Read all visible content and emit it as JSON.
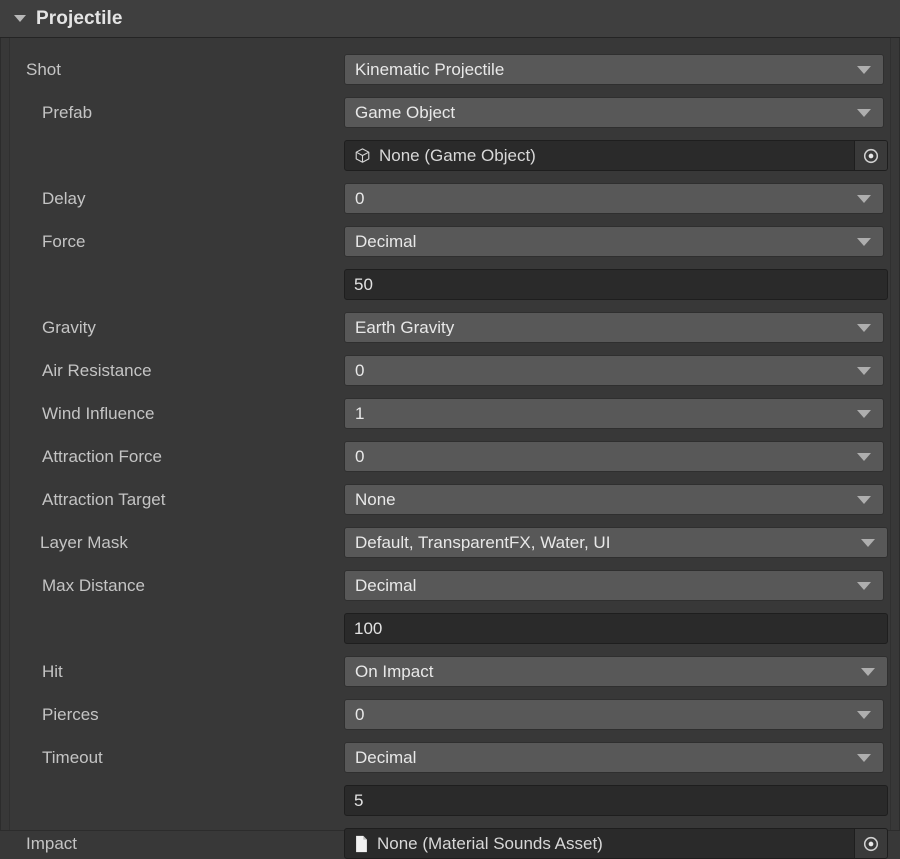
{
  "component": {
    "title": "Projectile",
    "foldout_icon": "chevron-down-icon",
    "expanded": true
  },
  "colors": {
    "panel_bg": "#383838",
    "header_bg": "#3f3f3f",
    "dropdown_bg": "#585858",
    "textfield_bg": "#2a2a2a",
    "label_text": "#c4c4c4",
    "value_text": "#e8e8e8"
  },
  "fields": [
    {
      "label": "Shot",
      "indent": 1,
      "control": "dropdown",
      "value": "Kinematic Projectile"
    },
    {
      "label": "Prefab",
      "indent": 2,
      "control": "dropdown",
      "value": "Game Object"
    },
    {
      "label": "",
      "indent": 2,
      "control": "objectfield",
      "value": "None (Game Object)",
      "icon": "cube-icon"
    },
    {
      "label": "Delay",
      "indent": 2,
      "control": "dropdown",
      "value": "0"
    },
    {
      "label": "Force",
      "indent": 2,
      "control": "dropdown",
      "value": "Decimal"
    },
    {
      "label": "",
      "indent": 2,
      "control": "textfield",
      "value": "50"
    },
    {
      "label": "Gravity",
      "indent": 2,
      "control": "dropdown",
      "value": "Earth Gravity"
    },
    {
      "label": "Air Resistance",
      "indent": 2,
      "control": "dropdown",
      "value": "0"
    },
    {
      "label": "Wind Influence",
      "indent": 2,
      "control": "dropdown",
      "value": "1"
    },
    {
      "label": "Attraction Force",
      "indent": 2,
      "control": "dropdown",
      "value": "0"
    },
    {
      "label": "Attraction Target",
      "indent": 2,
      "control": "dropdown",
      "value": "None"
    },
    {
      "label": "Layer Mask",
      "indent": 2,
      "control": "dropdown",
      "value": "Default, TransparentFX, Water, UI",
      "wide": true
    },
    {
      "label": "Max Distance",
      "indent": 2,
      "control": "dropdown",
      "value": "Decimal"
    },
    {
      "label": "",
      "indent": 2,
      "control": "textfield",
      "value": "100"
    },
    {
      "label": "Hit",
      "indent": 2,
      "control": "dropdown",
      "value": "On Impact",
      "wide": true
    },
    {
      "label": "Pierces",
      "indent": 2,
      "control": "dropdown",
      "value": "0"
    },
    {
      "label": "Timeout",
      "indent": 2,
      "control": "dropdown",
      "value": "Decimal"
    },
    {
      "label": "",
      "indent": 2,
      "control": "textfield",
      "value": "5"
    },
    {
      "label": "Impact",
      "indent": 1,
      "control": "objectfield",
      "value": "None (Material Sounds Asset)",
      "icon": "document-icon"
    }
  ]
}
